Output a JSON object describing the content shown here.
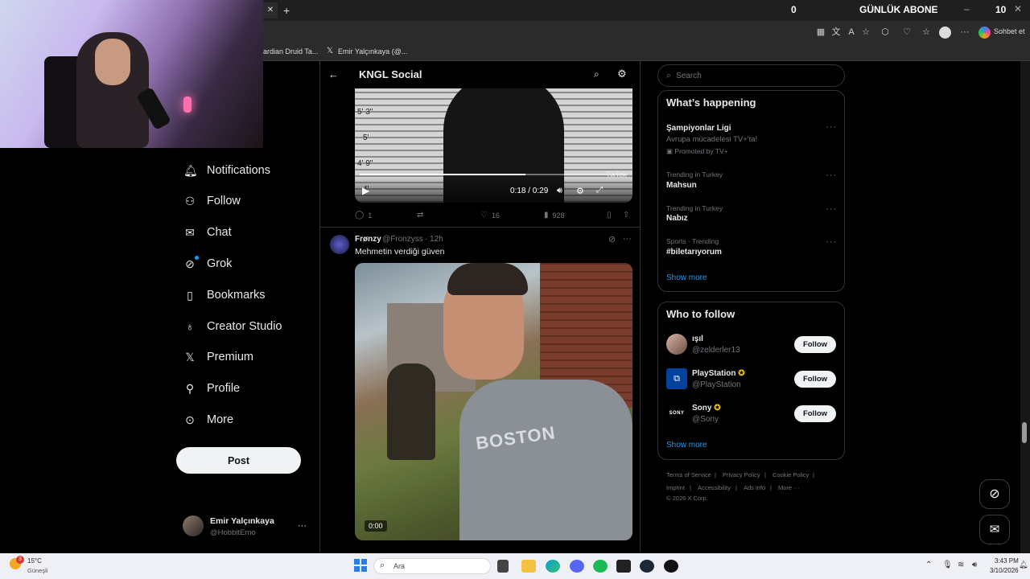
{
  "browser": {
    "tab_close": "✕",
    "new_tab": "+",
    "sub_count": "0",
    "sub_label": "GÜNLÜK ABONE",
    "sub_goal": "10",
    "copilot_label": "Sohbet et",
    "bookmarks": [
      "ardian Druid Ta...",
      "Emir Yalçınkaya (@..."
    ]
  },
  "nav": {
    "items": [
      {
        "label": "Notifications",
        "icon": "bell-icon"
      },
      {
        "label": "Follow",
        "icon": "person-plus-icon"
      },
      {
        "label": "Chat",
        "icon": "envelope-icon"
      },
      {
        "label": "Grok",
        "icon": "grok-icon"
      },
      {
        "label": "Bookmarks",
        "icon": "bookmark-icon"
      },
      {
        "label": "Creator Studio",
        "icon": "flask-icon"
      },
      {
        "label": "Premium",
        "icon": "x-logo-icon"
      },
      {
        "label": "Profile",
        "icon": "person-icon"
      },
      {
        "label": "More",
        "icon": "more-circle-icon"
      }
    ],
    "post_label": "Post",
    "account": {
      "name": "Emir Yalçınkaya",
      "handle": "@HobbitEmo",
      "more": "···"
    }
  },
  "header": {
    "title": "KNGL Social"
  },
  "post1": {
    "video": {
      "time": "0:18 / 0:29",
      "progress": 0.62,
      "watermark": "TikTok",
      "heights": [
        "5' 3\"",
        "5'",
        "4' 9\"",
        "4'"
      ]
    },
    "stats": {
      "replies": "1",
      "likes": "16",
      "views": "928"
    }
  },
  "post2": {
    "author": "Frønzy",
    "handle": "@Fronzyss",
    "time": "· 12h",
    "text": "Mehmetin verdiği güven",
    "video_time": "0:00",
    "shirt_text": "BOSTON"
  },
  "search": {
    "placeholder": "Search"
  },
  "whats_happening": {
    "title": "What’s happening",
    "trends": [
      {
        "title": "Şampiyonlar Ligi",
        "desc": "Avrupa mücadelesi TV+'ta!",
        "promo": "Promoted by TV+"
      },
      {
        "meta": "Trending in Turkey",
        "title": "Mahsun"
      },
      {
        "meta": "Trending in Turkey",
        "title": "Nabız"
      },
      {
        "meta": "Sports · Trending",
        "title": "#biletarıyorum"
      }
    ],
    "show_more": "Show more"
  },
  "who_to_follow": {
    "title": "Who to follow",
    "users": [
      {
        "name": "ışıl",
        "handle": "@zelderler13",
        "verified": false
      },
      {
        "name": "PlayStation",
        "handle": "@PlayStation",
        "verified": true
      },
      {
        "name": "Sony",
        "handle": "@Sony",
        "verified": true
      }
    ],
    "follow_label": "Follow",
    "show_more": "Show more"
  },
  "footer": {
    "line1": [
      "Terms of Service",
      "Privacy Policy",
      "Cookie Policy"
    ],
    "line2": [
      "Imprint",
      "Accessibility",
      "Ads info",
      "More ···"
    ],
    "copyright": "© 2026 X Corp."
  },
  "taskbar": {
    "temp": "15°C",
    "weather": "Güneşli",
    "badge": "3",
    "search": "Ara",
    "time": "3:43 PM",
    "date": "3/10/2026"
  },
  "colors": {
    "accent": "#1d9bf0",
    "bg": "#000000",
    "border": "#2f3336",
    "muted": "#71767b",
    "text": "#e7e9ea"
  }
}
